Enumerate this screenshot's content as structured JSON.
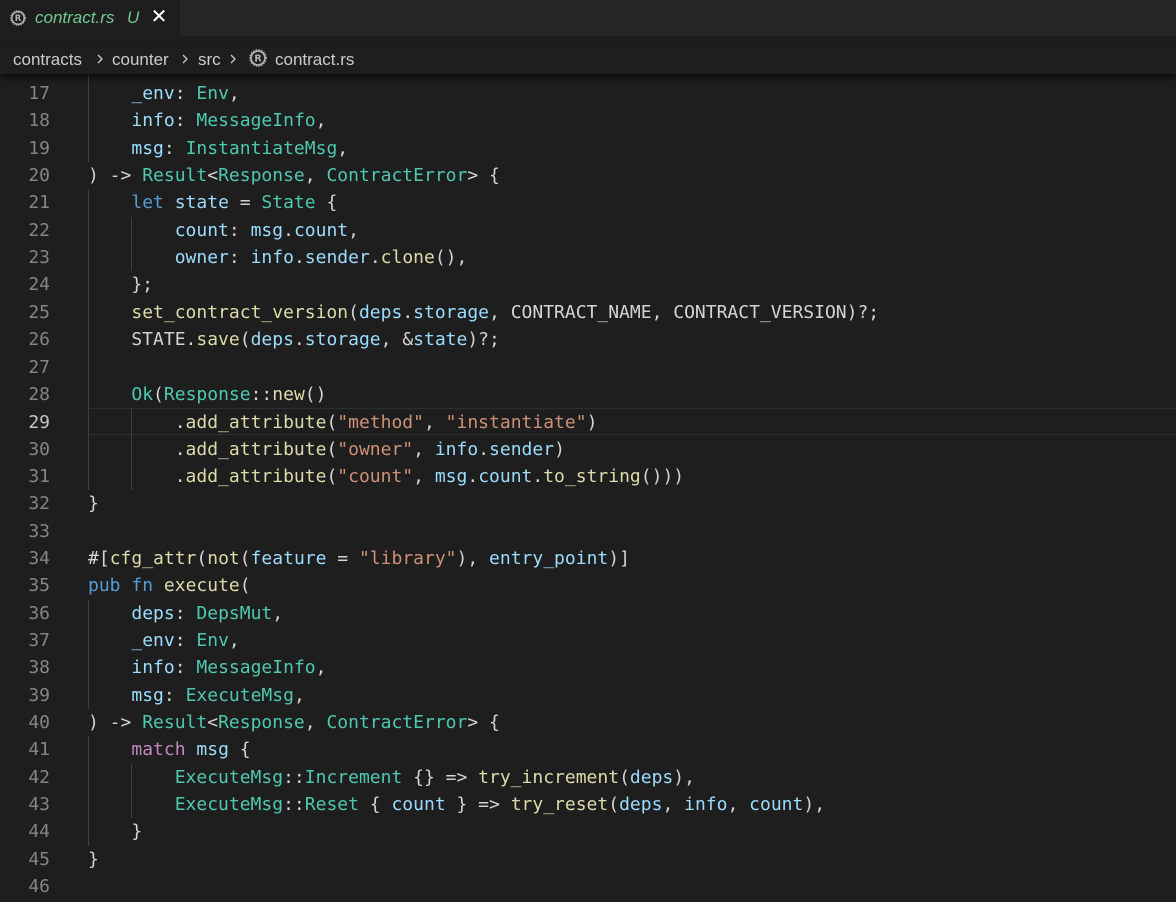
{
  "tab": {
    "icon": "rust-icon",
    "title": "contract.rs",
    "status": "U",
    "close": "✕"
  },
  "breadcrumb": {
    "items": [
      "contracts",
      "counter",
      "src",
      "contract.rs"
    ]
  },
  "editor": {
    "current_line": 29,
    "lines": [
      {
        "n": "17",
        "tokens": [
          [
            "    ",
            ""
          ],
          [
            "_env",
            "v"
          ],
          [
            ": ",
            ""
          ],
          [
            "Env",
            "t"
          ],
          [
            ",",
            ""
          ]
        ]
      },
      {
        "n": "18",
        "tokens": [
          [
            "    ",
            ""
          ],
          [
            "info",
            "v"
          ],
          [
            ": ",
            ""
          ],
          [
            "MessageInfo",
            "t"
          ],
          [
            ",",
            ""
          ]
        ]
      },
      {
        "n": "19",
        "tokens": [
          [
            "    ",
            ""
          ],
          [
            "msg",
            "v"
          ],
          [
            ": ",
            ""
          ],
          [
            "InstantiateMsg",
            "t"
          ],
          [
            ",",
            ""
          ]
        ]
      },
      {
        "n": "20",
        "tokens": [
          [
            ") -> ",
            ""
          ],
          [
            "Result",
            "t"
          ],
          [
            "<",
            ""
          ],
          [
            "Response",
            "t"
          ],
          [
            ", ",
            ""
          ],
          [
            "ContractError",
            "t"
          ],
          [
            "> {",
            ""
          ]
        ]
      },
      {
        "n": "21",
        "tokens": [
          [
            "    ",
            ""
          ],
          [
            "let",
            "k"
          ],
          [
            " ",
            ""
          ],
          [
            "state",
            "v"
          ],
          [
            " = ",
            ""
          ],
          [
            "State",
            "t"
          ],
          [
            " {",
            ""
          ]
        ]
      },
      {
        "n": "22",
        "tokens": [
          [
            "        ",
            ""
          ],
          [
            "count",
            "v"
          ],
          [
            ": ",
            ""
          ],
          [
            "msg",
            "v"
          ],
          [
            ".",
            ""
          ],
          [
            "count",
            "v"
          ],
          [
            ",",
            ""
          ]
        ]
      },
      {
        "n": "23",
        "tokens": [
          [
            "        ",
            ""
          ],
          [
            "owner",
            "v"
          ],
          [
            ": ",
            ""
          ],
          [
            "info",
            "v"
          ],
          [
            ".",
            ""
          ],
          [
            "sender",
            "v"
          ],
          [
            ".",
            ""
          ],
          [
            "clone",
            "f"
          ],
          [
            "(),",
            ""
          ]
        ]
      },
      {
        "n": "24",
        "tokens": [
          [
            "    };",
            ""
          ]
        ]
      },
      {
        "n": "25",
        "tokens": [
          [
            "    ",
            ""
          ],
          [
            "set_contract_version",
            "f"
          ],
          [
            "(",
            ""
          ],
          [
            "deps",
            "v"
          ],
          [
            ".",
            ""
          ],
          [
            "storage",
            "v"
          ],
          [
            ", CONTRACT_NAME, CONTRACT_VERSION)?;",
            ""
          ]
        ]
      },
      {
        "n": "26",
        "tokens": [
          [
            "    STATE.",
            ""
          ],
          [
            "save",
            "f"
          ],
          [
            "(",
            ""
          ],
          [
            "deps",
            "v"
          ],
          [
            ".",
            ""
          ],
          [
            "storage",
            "v"
          ],
          [
            ", &",
            ""
          ],
          [
            "state",
            "v"
          ],
          [
            ")?;",
            ""
          ]
        ]
      },
      {
        "n": "27",
        "tokens": []
      },
      {
        "n": "28",
        "tokens": [
          [
            "    ",
            ""
          ],
          [
            "Ok",
            "t"
          ],
          [
            "(",
            ""
          ],
          [
            "Response",
            "t"
          ],
          [
            "::",
            ""
          ],
          [
            "new",
            "f"
          ],
          [
            "()",
            ""
          ]
        ]
      },
      {
        "n": "29",
        "tokens": [
          [
            "        .",
            ""
          ],
          [
            "add_attribute",
            "f"
          ],
          [
            "(",
            ""
          ],
          [
            "\"method\"",
            "s"
          ],
          [
            ", ",
            ""
          ],
          [
            "\"instantiate\"",
            "s"
          ],
          [
            ")",
            ""
          ]
        ]
      },
      {
        "n": "30",
        "tokens": [
          [
            "        .",
            ""
          ],
          [
            "add_attribute",
            "f"
          ],
          [
            "(",
            ""
          ],
          [
            "\"owner\"",
            "s"
          ],
          [
            ", ",
            ""
          ],
          [
            "info",
            "v"
          ],
          [
            ".",
            ""
          ],
          [
            "sender",
            "v"
          ],
          [
            ")",
            ""
          ]
        ]
      },
      {
        "n": "31",
        "tokens": [
          [
            "        .",
            ""
          ],
          [
            "add_attribute",
            "f"
          ],
          [
            "(",
            ""
          ],
          [
            "\"count\"",
            "s"
          ],
          [
            ", ",
            ""
          ],
          [
            "msg",
            "v"
          ],
          [
            ".",
            ""
          ],
          [
            "count",
            "v"
          ],
          [
            ".",
            ""
          ],
          [
            "to_string",
            "f"
          ],
          [
            "()))",
            ""
          ]
        ]
      },
      {
        "n": "32",
        "tokens": [
          [
            "}",
            ""
          ]
        ]
      },
      {
        "n": "33",
        "tokens": []
      },
      {
        "n": "34",
        "tokens": [
          [
            "#[",
            ""
          ],
          [
            "cfg_attr",
            "f"
          ],
          [
            "(",
            ""
          ],
          [
            "not",
            "f"
          ],
          [
            "(",
            ""
          ],
          [
            "feature",
            "v"
          ],
          [
            " = ",
            ""
          ],
          [
            "\"library\"",
            "s"
          ],
          [
            "), ",
            ""
          ],
          [
            "entry_point",
            "v"
          ],
          [
            ")]",
            ""
          ]
        ]
      },
      {
        "n": "35",
        "tokens": [
          [
            "pub",
            "k"
          ],
          [
            " ",
            ""
          ],
          [
            "fn",
            "k"
          ],
          [
            " ",
            ""
          ],
          [
            "execute",
            "f"
          ],
          [
            "(",
            ""
          ]
        ]
      },
      {
        "n": "36",
        "tokens": [
          [
            "    ",
            ""
          ],
          [
            "deps",
            "v"
          ],
          [
            ": ",
            ""
          ],
          [
            "DepsMut",
            "t"
          ],
          [
            ",",
            ""
          ]
        ]
      },
      {
        "n": "37",
        "tokens": [
          [
            "    ",
            ""
          ],
          [
            "_env",
            "v"
          ],
          [
            ": ",
            ""
          ],
          [
            "Env",
            "t"
          ],
          [
            ",",
            ""
          ]
        ]
      },
      {
        "n": "38",
        "tokens": [
          [
            "    ",
            ""
          ],
          [
            "info",
            "v"
          ],
          [
            ": ",
            ""
          ],
          [
            "MessageInfo",
            "t"
          ],
          [
            ",",
            ""
          ]
        ]
      },
      {
        "n": "39",
        "tokens": [
          [
            "    ",
            ""
          ],
          [
            "msg",
            "v"
          ],
          [
            ": ",
            ""
          ],
          [
            "ExecuteMsg",
            "t"
          ],
          [
            ",",
            ""
          ]
        ]
      },
      {
        "n": "40",
        "tokens": [
          [
            ") -> ",
            ""
          ],
          [
            "Result",
            "t"
          ],
          [
            "<",
            ""
          ],
          [
            "Response",
            "t"
          ],
          [
            ", ",
            ""
          ],
          [
            "ContractError",
            "t"
          ],
          [
            "> {",
            ""
          ]
        ]
      },
      {
        "n": "41",
        "tokens": [
          [
            "    ",
            ""
          ],
          [
            "match",
            "c"
          ],
          [
            " ",
            ""
          ],
          [
            "msg",
            "v"
          ],
          [
            " {",
            ""
          ]
        ]
      },
      {
        "n": "42",
        "tokens": [
          [
            "        ",
            ""
          ],
          [
            "ExecuteMsg",
            "t"
          ],
          [
            "::",
            ""
          ],
          [
            "Increment",
            "t"
          ],
          [
            " {} => ",
            ""
          ],
          [
            "try_increment",
            "f"
          ],
          [
            "(",
            ""
          ],
          [
            "deps",
            "v"
          ],
          [
            "),",
            ""
          ]
        ]
      },
      {
        "n": "43",
        "tokens": [
          [
            "        ",
            ""
          ],
          [
            "ExecuteMsg",
            "t"
          ],
          [
            "::",
            ""
          ],
          [
            "Reset",
            "t"
          ],
          [
            " { ",
            ""
          ],
          [
            "count",
            "v"
          ],
          [
            " } => ",
            ""
          ],
          [
            "try_reset",
            "f"
          ],
          [
            "(",
            ""
          ],
          [
            "deps",
            "v"
          ],
          [
            ", ",
            ""
          ],
          [
            "info",
            "v"
          ],
          [
            ", ",
            ""
          ],
          [
            "count",
            "v"
          ],
          [
            "),",
            ""
          ]
        ]
      },
      {
        "n": "44",
        "tokens": [
          [
            "    }",
            ""
          ]
        ]
      },
      {
        "n": "45",
        "tokens": [
          [
            "}",
            ""
          ]
        ]
      },
      {
        "n": "46",
        "tokens": []
      }
    ]
  },
  "colors": {
    "keyword": "#569cd6",
    "control": "#c586c0",
    "variable": "#9cdcfe",
    "type": "#4ec9b0",
    "function": "#dcdcaa",
    "string": "#ce9178",
    "modified": "#73c991"
  }
}
